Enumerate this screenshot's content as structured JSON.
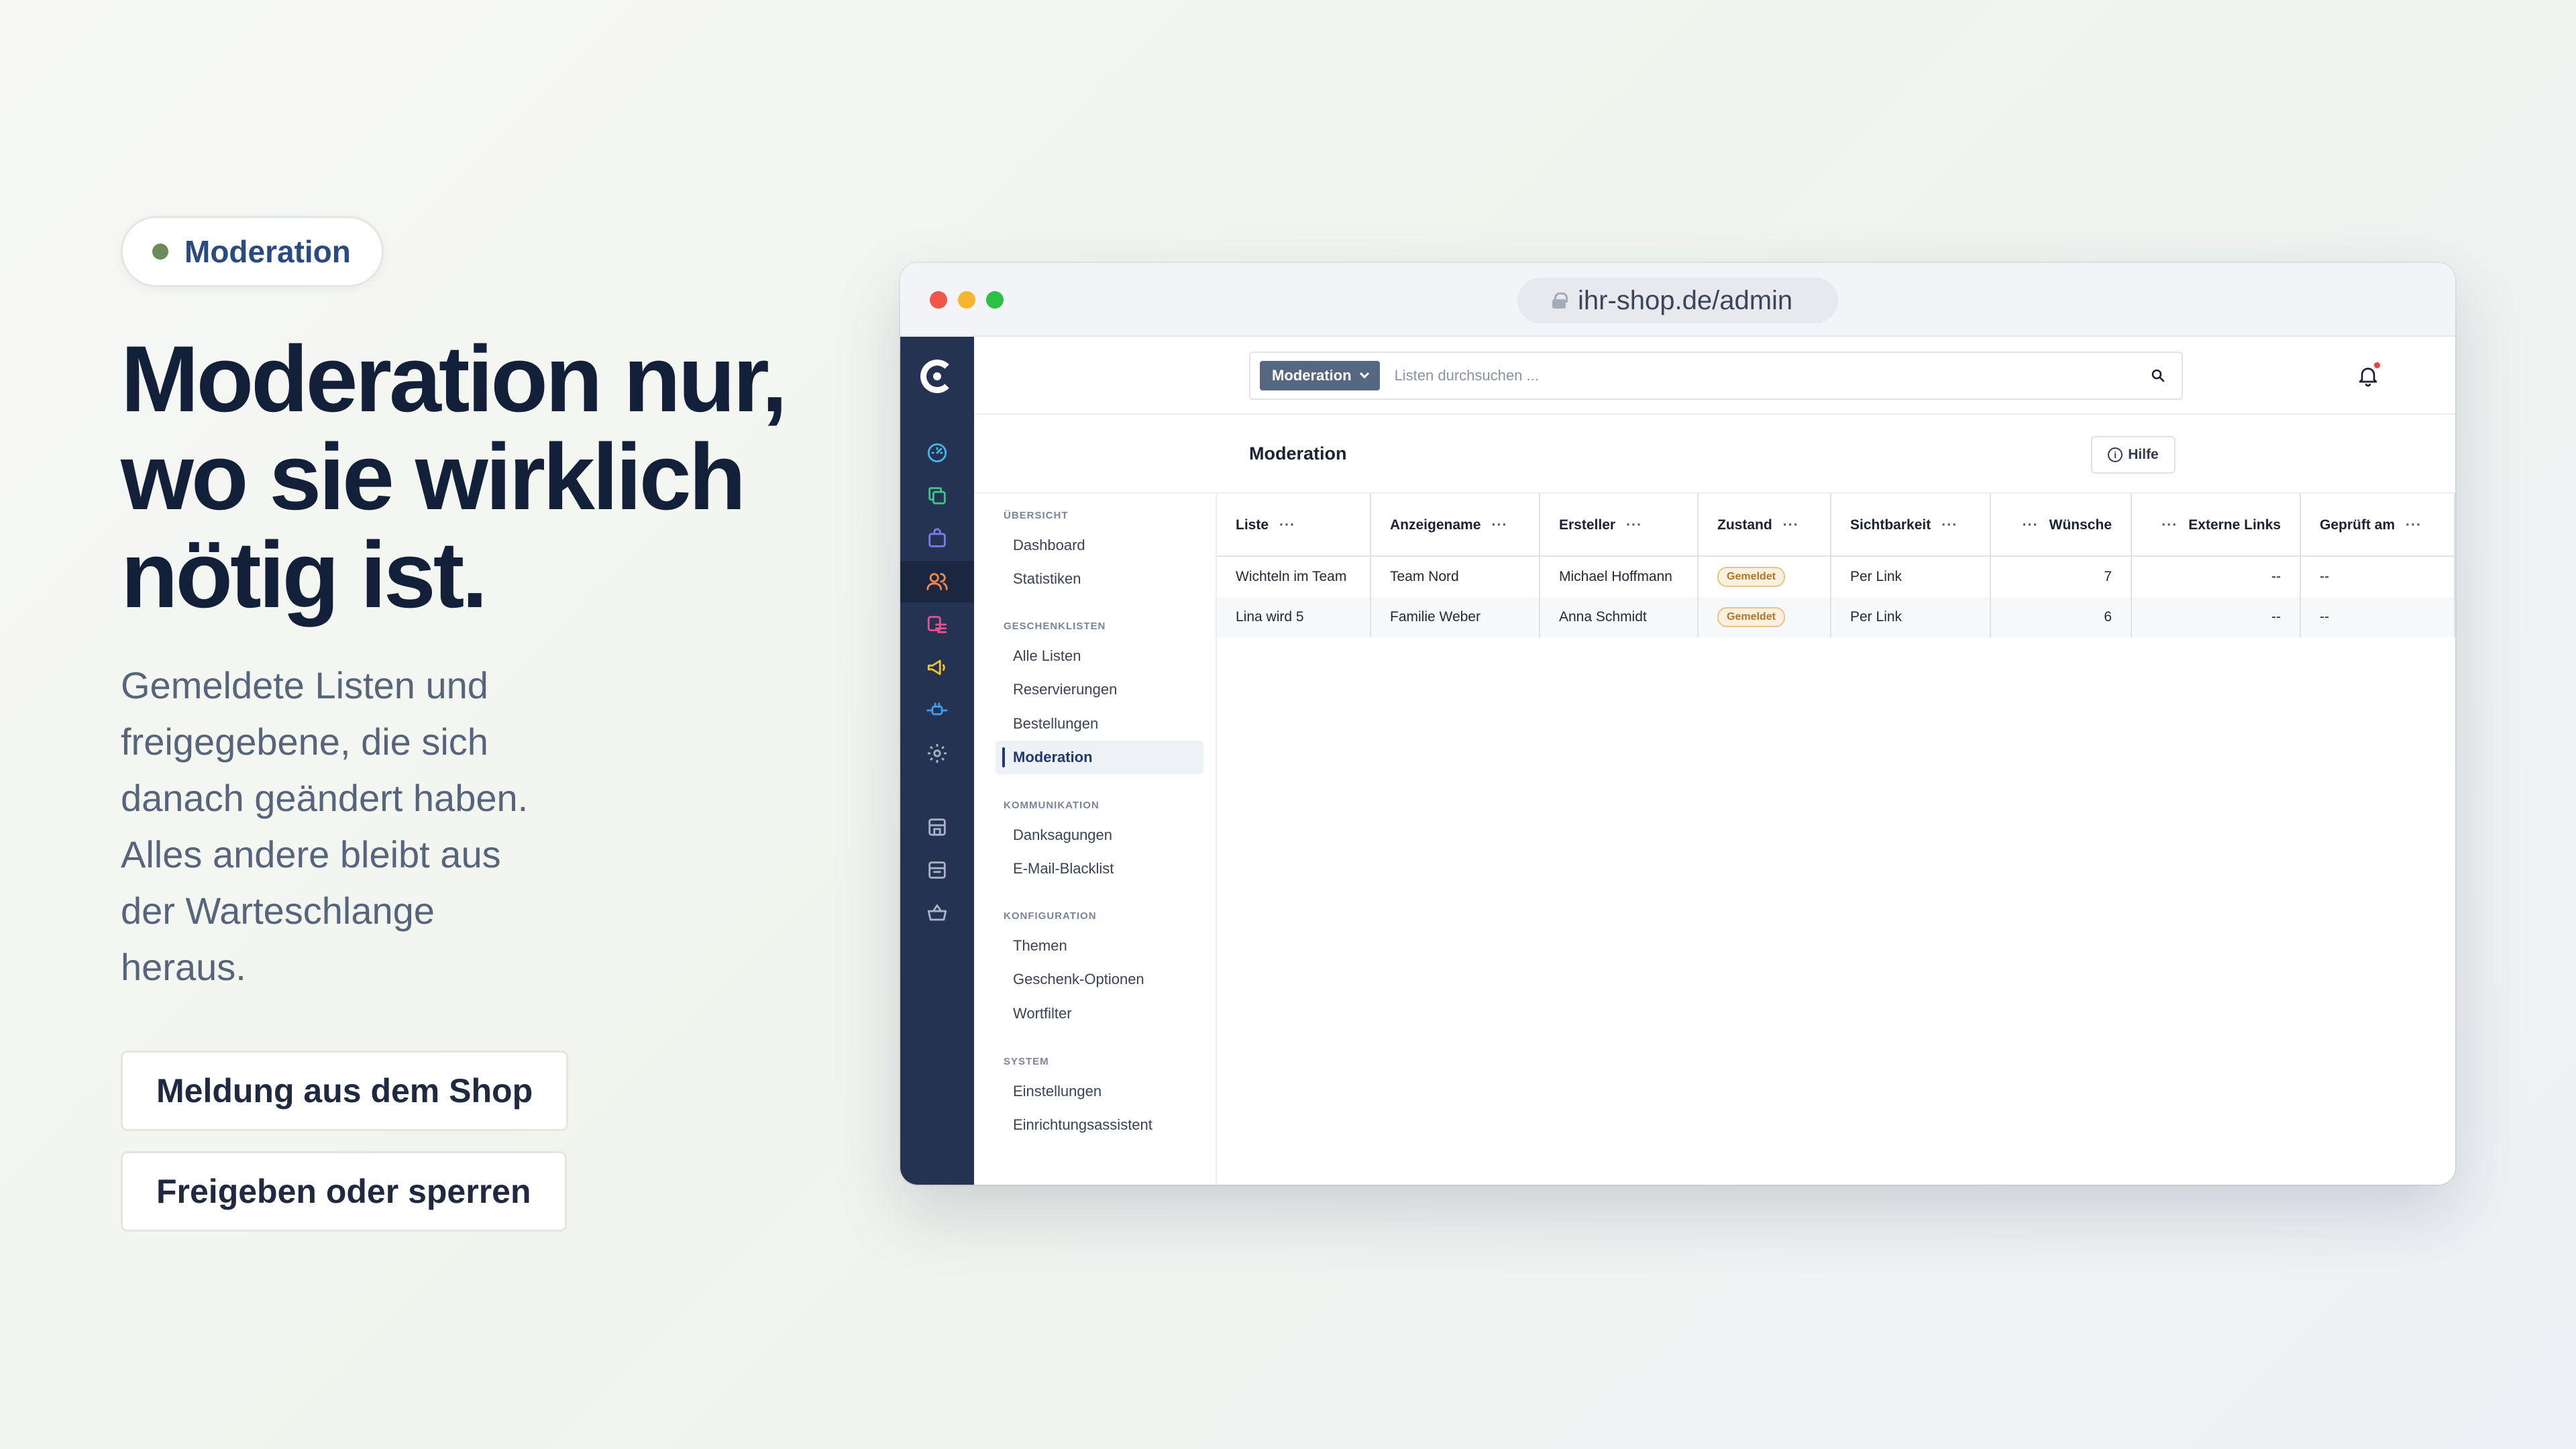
{
  "hero": {
    "pill_label": "Moderation",
    "headline_lines": [
      "Moderation nur,",
      "wo sie wirklich",
      "nötig ist."
    ],
    "lead_lines": [
      "Gemeldete Listen und",
      "freigegebene, die sich",
      "danach geändert haben.",
      "Alles andere bleibt aus",
      "der Warteschlange",
      "heraus."
    ],
    "cta": [
      "Meldung aus dem Shop",
      "Freigeben oder sperren"
    ]
  },
  "browser": {
    "url": "ihr-shop.de/admin"
  },
  "rail": {
    "icons": [
      "speedometer-icon",
      "copy-icon",
      "bag-icon",
      "users-icon",
      "list-icon",
      "megaphone-icon",
      "plug-icon",
      "gear-icon",
      "store-icon",
      "store-alt-icon",
      "basket-icon"
    ],
    "active_index": 3,
    "colors": {
      "speedometer": "#45b6e8",
      "copy": "#3fc38a",
      "bag": "#7d7ae6",
      "users": "#f08a4b",
      "list": "#ec4f8f",
      "megaphone": "#f2c12e",
      "plug": "#3b9ef2",
      "gear": "#a9b2c5"
    }
  },
  "topbar": {
    "search_scope": "Moderation",
    "search_placeholder": "Listen durchsuchen ..."
  },
  "page": {
    "title": "Moderation",
    "help_label": "Hilfe"
  },
  "nav": {
    "groups": [
      {
        "title": "ÜBERSICHT",
        "items": [
          "Dashboard",
          "Statistiken"
        ]
      },
      {
        "title": "GESCHENKLISTEN",
        "items": [
          "Alle Listen",
          "Reservierungen",
          "Bestellungen",
          "Moderation"
        ]
      },
      {
        "title": "KOMMUNIKATION",
        "items": [
          "Danksagungen",
          "E-Mail-Blacklist"
        ]
      },
      {
        "title": "KONFIGURATION",
        "items": [
          "Themen",
          "Geschenk-Optionen",
          "Wortfilter"
        ]
      },
      {
        "title": "SYSTEM",
        "items": [
          "Einstellungen",
          "Einrichtungsassistent"
        ]
      }
    ],
    "active_item": "Moderation"
  },
  "table": {
    "columns": [
      "Liste",
      "Anzeigename",
      "Ersteller",
      "Zustand",
      "Sichtbarkeit",
      "Wünsche",
      "Externe Links",
      "Geprüft am"
    ],
    "column_menu": "···",
    "rows": [
      [
        "Wichteln im Team",
        "Team Nord",
        "Michael Hoffmann",
        "Gemeldet",
        "Per Link",
        "7",
        "--",
        "--"
      ],
      [
        "Lina wird 5",
        "Familie Weber",
        "Anna Schmidt",
        "Gemeldet",
        "Per Link",
        "6",
        "--",
        "--"
      ]
    ]
  }
}
